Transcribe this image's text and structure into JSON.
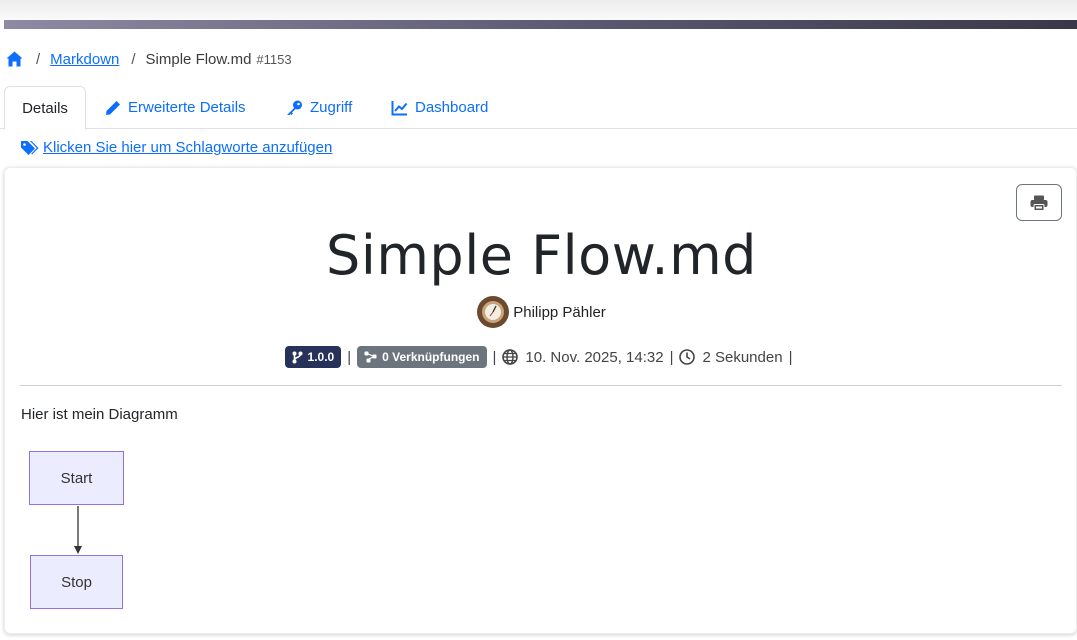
{
  "breadcrumb": {
    "home_icon": "home-icon",
    "separator": "/",
    "parent": "Markdown",
    "current": "Simple Flow.md",
    "number": "#1153"
  },
  "tabs": [
    {
      "label": "Details",
      "icon": "",
      "active": true
    },
    {
      "label": "Erweiterte Details",
      "icon": "pencil-icon"
    },
    {
      "label": "Zugriff",
      "icon": "key-icon"
    },
    {
      "label": "Dashboard",
      "icon": "chart-line-icon"
    }
  ],
  "tags_link": "Klicken Sie hier um Schlagworte anzufügen",
  "document": {
    "title": "Simple Flow.md",
    "author": "Philipp Pähler",
    "version": "1.0.0",
    "links": "0 Verknüpfungen",
    "date": "10. Nov. 2025, 14:32",
    "duration": "2 Sekunden",
    "pipe": "|",
    "intro": "Hier ist mein Diagramm"
  },
  "diagram": {
    "nodes": [
      "Start",
      "Stop"
    ],
    "edges": [
      [
        "Start",
        "Stop"
      ]
    ]
  },
  "colors": {
    "link": "#0d6efd",
    "version_badge": "#27325a",
    "links_badge": "#6c757d",
    "node_fill": "#ececff",
    "node_border": "#9370db"
  }
}
